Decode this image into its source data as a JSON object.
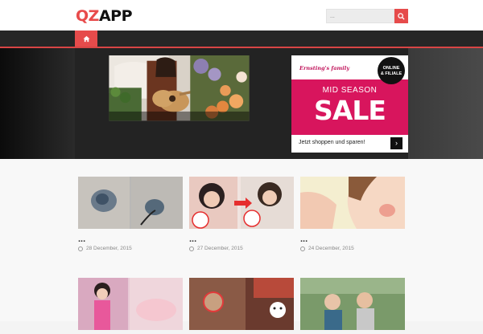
{
  "header": {
    "logo_part1": "QZ",
    "logo_part2": "APP",
    "search": {
      "placeholder": "..."
    }
  },
  "nav": {
    "home_icon": "home-icon"
  },
  "ad": {
    "brand": "Ernsting's family",
    "badge_line1": "ONLINE",
    "badge_line2": "& FILIALE",
    "mid": "MID SEASON",
    "sale": "SALE",
    "cta": "Jetzt shoppen und sparen!",
    "arrow": "›"
  },
  "posts": [
    {
      "title": "...",
      "date": "28 December, 2015"
    },
    {
      "title": "...",
      "date": "27 December, 2015"
    },
    {
      "title": "...",
      "date": "24 December, 2015"
    },
    {
      "title": "",
      "date": ""
    },
    {
      "title": "",
      "date": ""
    },
    {
      "title": "",
      "date": ""
    }
  ],
  "colors": {
    "accent": "#e64b4b",
    "nav_bg": "#262626",
    "ad_bg": "#d8155d"
  }
}
